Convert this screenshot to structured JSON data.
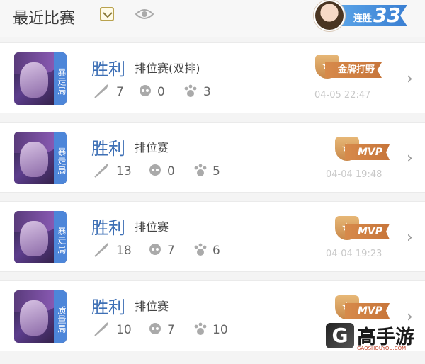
{
  "header": {
    "title": "最近比赛",
    "filter_icon": "check-box-icon",
    "view_icon": "eye-icon"
  },
  "streak": {
    "label": "连胜",
    "count": "33",
    "accent": "#4a8fdc"
  },
  "matches": [
    {
      "hero_tag": "暴走局",
      "result": "胜利",
      "mode": "排位赛(双排)",
      "kills": "7",
      "deaths": "0",
      "assists": "3",
      "badge": "金牌打野",
      "badge_type": "gold",
      "time": "04-05 22:47"
    },
    {
      "hero_tag": "暴走局",
      "result": "胜利",
      "mode": "排位赛",
      "kills": "13",
      "deaths": "0",
      "assists": "5",
      "badge": "MVP",
      "badge_type": "mvp",
      "time": "04-04 19:48"
    },
    {
      "hero_tag": "暴走局",
      "result": "胜利",
      "mode": "排位赛",
      "kills": "18",
      "deaths": "7",
      "assists": "6",
      "badge": "MVP",
      "badge_type": "mvp",
      "time": "04-04 19:23"
    },
    {
      "hero_tag": "质量局",
      "result": "胜利",
      "mode": "排位赛",
      "kills": "10",
      "deaths": "7",
      "assists": "10",
      "badge": "MVP",
      "badge_type": "mvp",
      "time": ""
    }
  ],
  "watermark": {
    "logo_letter": "G",
    "text": "高手游",
    "url": "GAOSHOUYOU.COM"
  },
  "colors": {
    "result_blue": "#3d6fb5",
    "tag_blue": "#4d86d9",
    "badge_orange": "#d78a4b"
  }
}
